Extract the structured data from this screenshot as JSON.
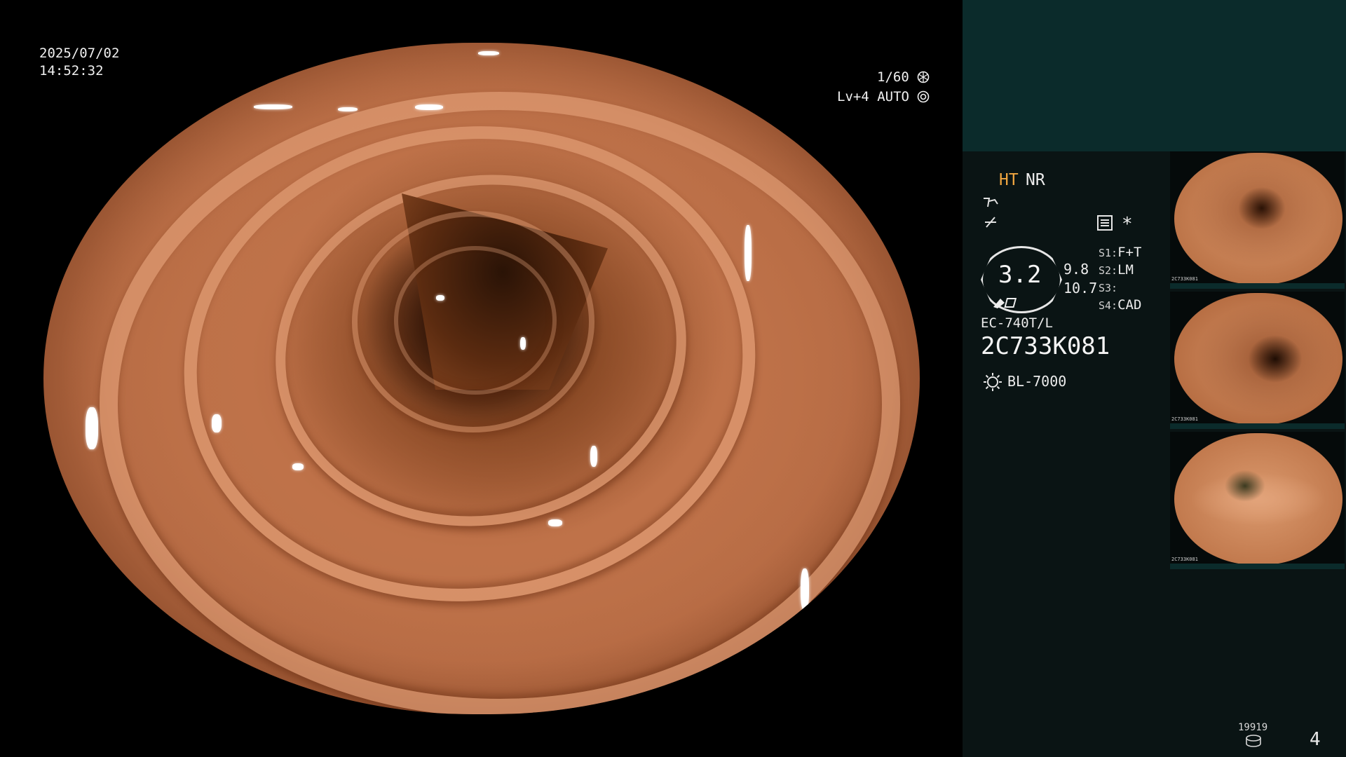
{
  "overlay": {
    "date": "2025/07/02",
    "time": "14:52:32",
    "shutter": "1/60",
    "level": "Lv+4",
    "mode": "AUTO"
  },
  "panel": {
    "mode_ht": "HT",
    "mode_nr": "NR",
    "zoom_value": "3.2",
    "zoom_right_top": "9.8",
    "zoom_right_bottom": "10.7",
    "switches": [
      {
        "key": "S1:",
        "value": "F+T"
      },
      {
        "key": "S2:",
        "value": "LM"
      },
      {
        "key": "S3:",
        "value": ""
      },
      {
        "key": "S4:",
        "value": "CAD"
      }
    ],
    "scope_model": "EC-740T/L",
    "serial": "2C733K081",
    "light_source": "BL-7000",
    "asterisk": "*",
    "counter": "19919",
    "page_number": "4"
  },
  "thumbnails": [
    {
      "serial": "2C733K081"
    },
    {
      "serial": "2C733K081"
    },
    {
      "serial": "2C733K081"
    }
  ],
  "colors": {
    "accent_ht": "#f0a640",
    "panel_top": "#0b2b2b",
    "panel_bg": "#0a1414"
  },
  "icons": {
    "shutter": "aperture-icon",
    "mode": "iris-icon",
    "light": "light-source-icon",
    "storage": "storage-icon",
    "menu": "menu-icon"
  }
}
